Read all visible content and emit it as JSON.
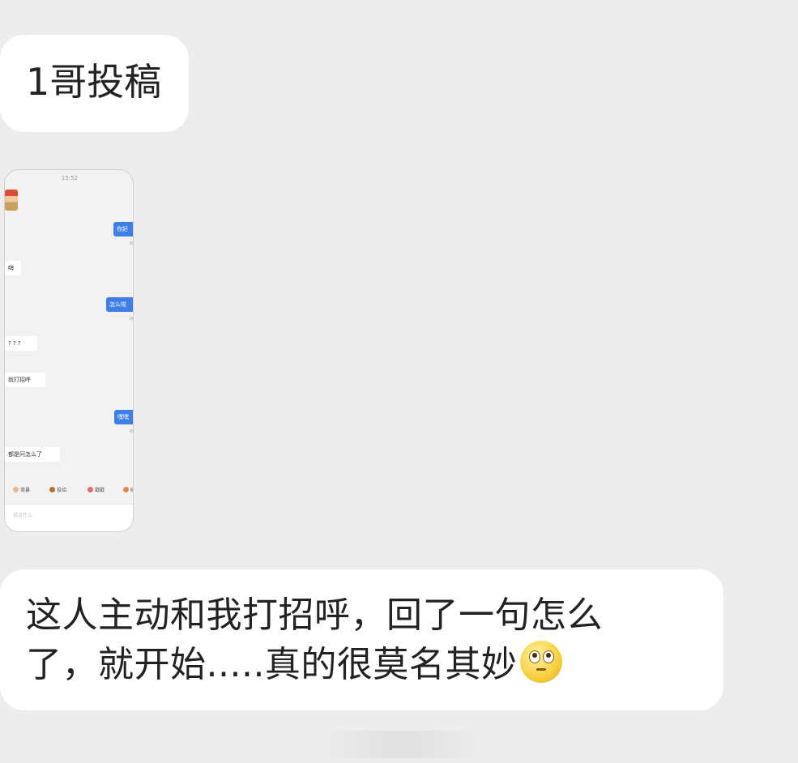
{
  "messages": [
    {
      "text": "1哥投稿"
    },
    {
      "text_line1": "这人主动和我打招呼，回了一句怎么",
      "text_line2": "了，就开始.....真的很莫名其妙"
    }
  ],
  "emoji": "eye-roll-face-icon",
  "thumbnail": {
    "time": "15:52",
    "msg1": "你好",
    "msg2": "嗨",
    "msg3": "怎么啦",
    "msg4": "? ? ?",
    "msg5": "就打招呼",
    "msg6": "嘿嘿",
    "msg7": "都是问怎么了",
    "quick": [
      "常暴",
      "投绍",
      "戳戳",
      "碰"
    ],
    "input_placeholder": "说点什么"
  },
  "colors": {
    "background": "#ededed",
    "bubble": "#ffffff",
    "sent_bubble": "#3f7ee8"
  }
}
